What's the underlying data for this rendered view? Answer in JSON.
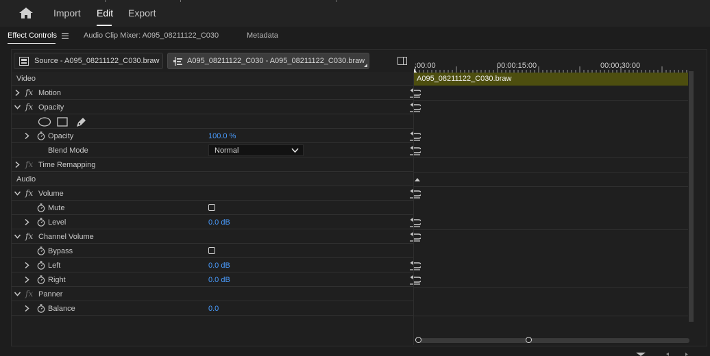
{
  "header": {
    "nav": [
      "Import",
      "Edit",
      "Export"
    ],
    "active": "Edit"
  },
  "tabs": {
    "effect_controls": "Effect Controls",
    "audio_clip_mixer": "Audio Clip Mixer: A095_08211122_C030",
    "metadata": "Metadata"
  },
  "source": {
    "source_label": "Source - A095_08211122_C030.braw",
    "clip_label": "A095_08211122_C030 - A095_08211122_C030.braw"
  },
  "effects": {
    "video_header": "Video",
    "motion": "Motion",
    "opacity_group": "Opacity",
    "opacity_param": "Opacity",
    "opacity_value": "100.0 %",
    "blend_mode_label": "Blend Mode",
    "blend_mode_value": "Normal",
    "time_remapping": "Time Remapping",
    "audio_header": "Audio",
    "volume": "Volume",
    "mute": "Mute",
    "level": "Level",
    "level_value": "0.0 dB",
    "channel_volume": "Channel Volume",
    "bypass": "Bypass",
    "left": "Left",
    "left_value": "0.0 dB",
    "right": "Right",
    "right_value": "0.0 dB",
    "panner": "Panner",
    "balance": "Balance",
    "balance_value": "0.0"
  },
  "timeline": {
    "tc0": ":00:00",
    "tc1": "00:00:15:00",
    "tc2": "00:00:30:00",
    "clip_name": "A095_08211122_C030.braw",
    "clip_color": "#4d4e0f"
  },
  "colors": {
    "value_blue": "#4a9dff",
    "background": "#1d1d1d"
  }
}
